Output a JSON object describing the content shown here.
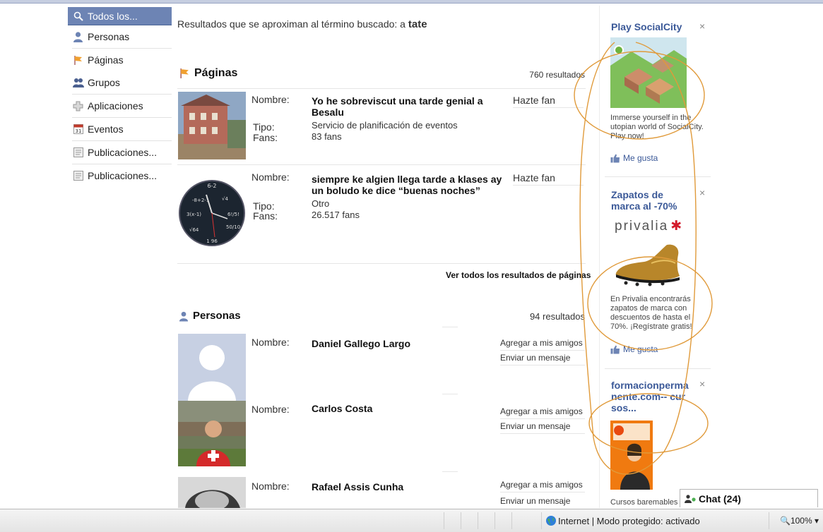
{
  "nav": {
    "items": [
      {
        "label": "Todos los...",
        "icon": "search-icon"
      },
      {
        "label": "Personas",
        "icon": "person-icon"
      },
      {
        "label": "Páginas",
        "icon": "flag-icon"
      },
      {
        "label": "Grupos",
        "icon": "group-icon"
      },
      {
        "label": "Aplicaciones",
        "icon": "puzzle-icon"
      },
      {
        "label": "Eventos",
        "icon": "calendar-icon"
      },
      {
        "label": "Publicaciones...",
        "icon": "post-icon"
      },
      {
        "label": "Publicaciones...",
        "icon": "post-icon"
      }
    ]
  },
  "search": {
    "prefix": "Resultados que se aproximan al término buscado: a",
    "term": "tate"
  },
  "pages": {
    "title": "Páginas",
    "count": "760 resultados",
    "labels": {
      "nombre": "Nombre:",
      "tipo": "Tipo:",
      "fans": "Fans:"
    },
    "items": [
      {
        "name": "Yo he sobreviscut una tarde genial a Besalu",
        "type": "Servicio de planificación de eventos",
        "fans": "83 fans",
        "action": "Hazte fan"
      },
      {
        "name": "siempre ke algien llega tarde a klases ay un boludo ke dice “buenas noches”",
        "type": "Otro",
        "fans": "26.517 fans",
        "action": "Hazte fan"
      }
    ],
    "see_all": "Ver todos los resultados de páginas"
  },
  "people": {
    "title": "Personas",
    "count": "94 resultados",
    "label": "Nombre:",
    "add_label": "Agregar a mis amigos",
    "msg_label": "Enviar un mensaje",
    "items": [
      {
        "name": "Daniel Gallego Largo"
      },
      {
        "name": "Carlos Costa"
      },
      {
        "name": "Rafael Assis Cunha"
      }
    ]
  },
  "ads": [
    {
      "title": "Play SocialCity",
      "text": "Immerse yourself in the utopian world of SocialCity. Play now!",
      "like": "Me gusta"
    },
    {
      "title": "Zapatos de marca al -70%",
      "brand": "privalia",
      "text": "En Privalia encontrarás zapatos de marca con descuentos de hasta el 70%. ¡Regístrate gratis!",
      "like": "Me gusta"
    },
    {
      "title": "formacionpermanente.com-- cursos...",
      "text": "Cursos baremables pa"
    }
  ],
  "close_glyph": "×",
  "chat": {
    "label": "Chat (24)"
  },
  "status": {
    "text": "Internet | Modo protegido: activado",
    "zoom": "100%"
  },
  "colors": {
    "nav_active": "#6d84b4",
    "link": "#3b5998",
    "annotation": "#e09a3a"
  }
}
